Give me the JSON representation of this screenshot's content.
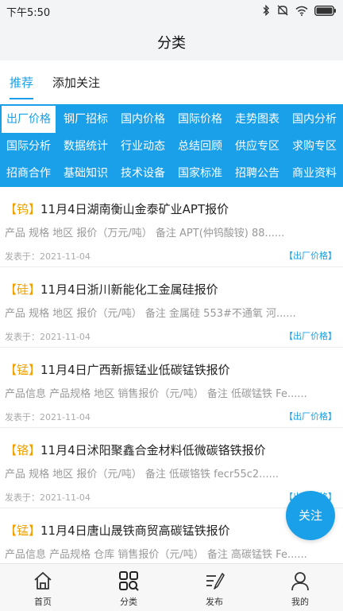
{
  "status_bar": {
    "time": "下午5:50",
    "icons": [
      "bluetooth-icon",
      "mute-icon",
      "wifi-icon",
      "battery-icon"
    ]
  },
  "header": {
    "title": "分类"
  },
  "tabs": [
    {
      "label": "推荐",
      "active": true
    },
    {
      "label": "添加关注",
      "active": false
    }
  ],
  "categories": [
    {
      "label": "出厂价格",
      "selected": true
    },
    {
      "label": "钢厂招标"
    },
    {
      "label": "国内价格"
    },
    {
      "label": "国际价格"
    },
    {
      "label": "走势图表"
    },
    {
      "label": "国内分析"
    },
    {
      "label": "国际分析"
    },
    {
      "label": "数据统计"
    },
    {
      "label": "行业动态"
    },
    {
      "label": "总结回顾"
    },
    {
      "label": "供应专区"
    },
    {
      "label": "求购专区"
    },
    {
      "label": "招商合作"
    },
    {
      "label": "基础知识"
    },
    {
      "label": "技术设备"
    },
    {
      "label": "国家标准"
    },
    {
      "label": "招聘公告"
    },
    {
      "label": "商业资料"
    }
  ],
  "articles": [
    {
      "tag": "【钨】",
      "title": "11月4日湖南衡山金泰矿业APT报价",
      "desc": "产品 规格 地区 报价（万元/吨） 备注  APT(仲钨酸铵) 88......",
      "date": "发表于：2021-11-04",
      "category": "【出厂价格】"
    },
    {
      "tag": "【硅】",
      "title": "11月4日浙川新能化工金属硅报价",
      "desc": "产品 规格 地区 报价（元/吨） 备注  金属硅 553#不通氧 河......",
      "date": "发表于：2021-11-04",
      "category": "【出厂价格】"
    },
    {
      "tag": "【锰】",
      "title": "11月4日广西新振锰业低碳锰铁报价",
      "desc": "产品信息 产品规格 地区 销售报价（元/吨） 备注  低碳锰铁 Fe......",
      "date": "发表于：2021-11-04",
      "category": "【出厂价格】"
    },
    {
      "tag": "【铬】",
      "title": "11月4日沭阳聚鑫合金材料低微碳铬铁报价",
      "desc": "产品 规格 地区 报价（元/吨） 备注  低碳铬铁 fecr55c2......",
      "date": "发表于：2021-11-04",
      "category": "【出厂价格】"
    },
    {
      "tag": "【锰】",
      "title": "11月4日唐山晟铁商贸高碳锰铁报价",
      "desc": "产品信息 产品规格 仓库 销售报价（元/吨） 备注  高碳锰铁 Fe......",
      "date": "",
      "category": ""
    }
  ],
  "fab": {
    "label": "关注"
  },
  "bottom_nav": [
    {
      "label": "首页",
      "icon": "home-icon"
    },
    {
      "label": "分类",
      "icon": "category-search-icon",
      "active": true
    },
    {
      "label": "发布",
      "icon": "publish-icon"
    },
    {
      "label": "我的",
      "icon": "user-icon"
    }
  ],
  "colors": {
    "accent": "#1aa0e8",
    "tag": "#f0a000",
    "header_bg": "#f3f4f6"
  }
}
